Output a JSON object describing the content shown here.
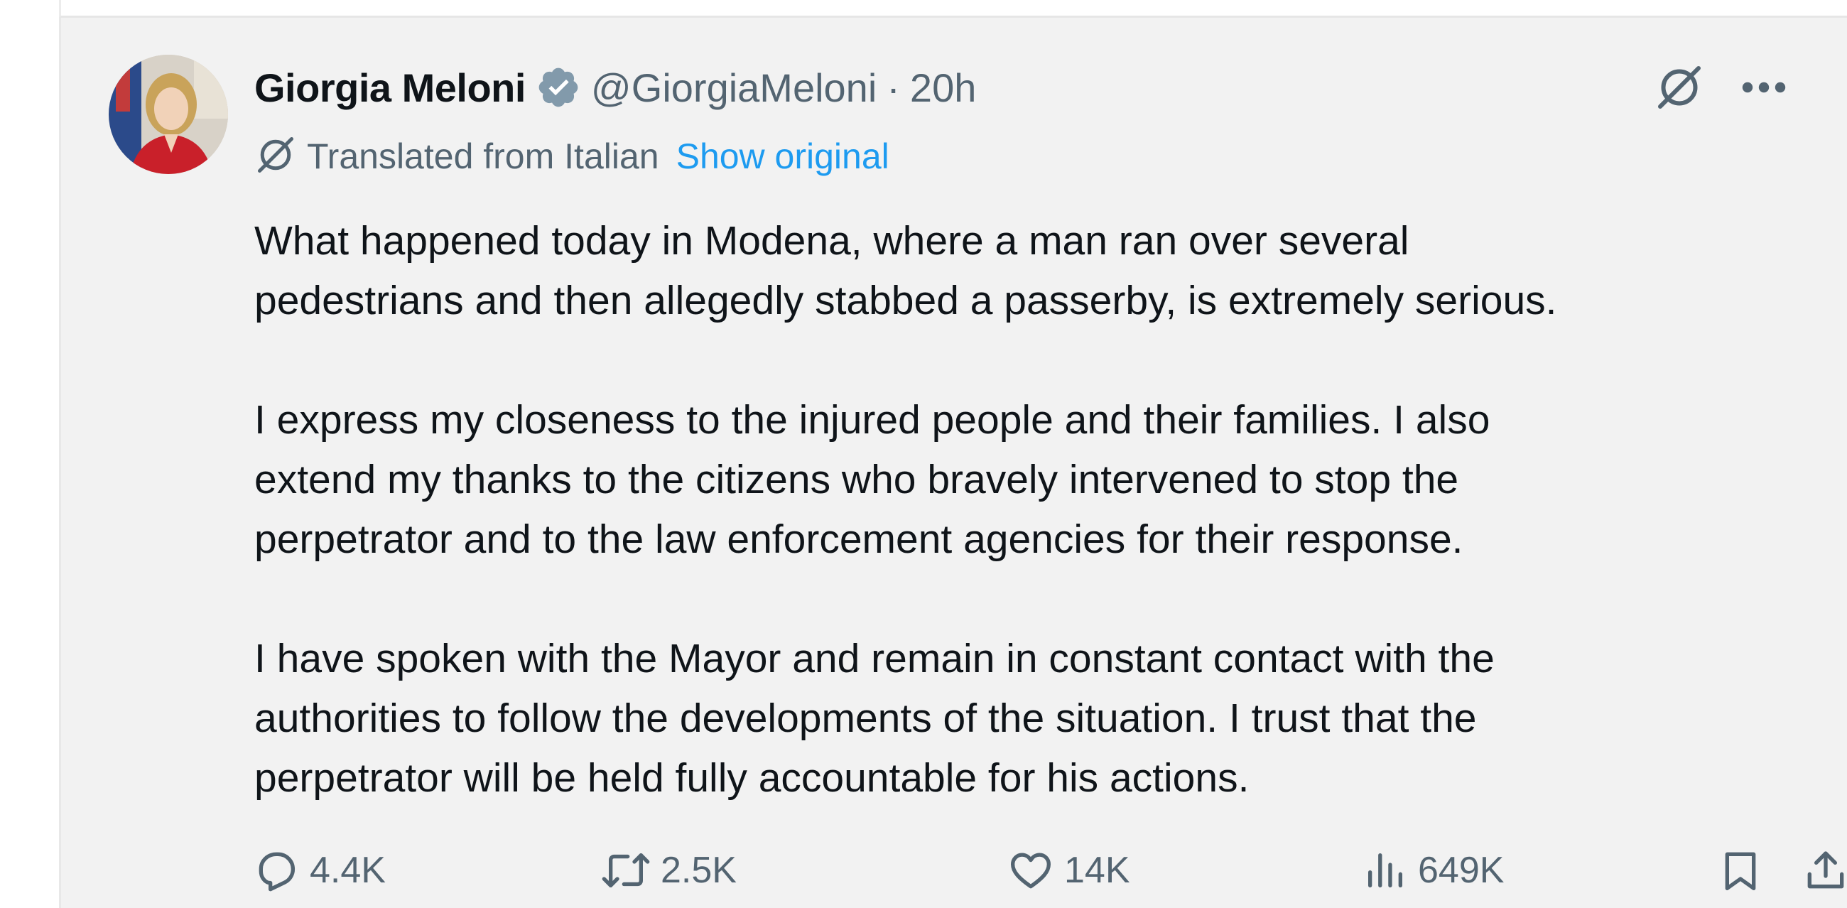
{
  "author": {
    "name": "Giorgia Meloni",
    "handle": "@GiorgiaMeloni",
    "separator": "·",
    "time": "20h",
    "verified": true
  },
  "translation": {
    "label": "Translated from Italian",
    "show_original": "Show original"
  },
  "body": {
    "paragraphs": [
      "What happened today in Modena, where a man ran over several\npedestrians and then allegedly stabbed a passerby, is extremely serious.",
      "I express my closeness to the injured people and their families. I also\nextend my thanks to the citizens who bravely intervened to stop the\nperpetrator and to the law enforcement agencies for their response.",
      "I have spoken with the Mayor and remain in constant contact with the\nauthorities to follow the developments of the situation. I trust that the\nperpetrator will be held fully accountable for his actions."
    ]
  },
  "actions": {
    "replies": "4.4K",
    "reposts": "2.5K",
    "likes": "14K",
    "views": "649K"
  },
  "icons": {
    "verified": "verified-badge-icon",
    "grok": "grok-icon",
    "more": "more-icon",
    "translate": "grok-translate-icon",
    "reply": "reply-icon",
    "repost": "repost-icon",
    "like": "heart-icon",
    "views": "views-chart-icon",
    "bookmark": "bookmark-icon",
    "share": "share-icon"
  },
  "colors": {
    "name": "#0f1419",
    "secondary": "#536471",
    "link": "#1d9bf0",
    "background": "#f2f2f2",
    "verified_badge": "#829aab"
  }
}
